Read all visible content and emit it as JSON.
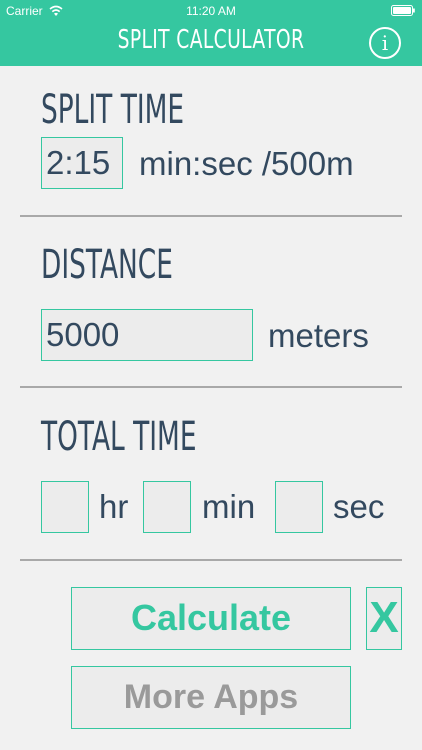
{
  "status_bar": {
    "carrier": "Carrier",
    "time": "11:20 AM",
    "wifi_icon": "wifi-icon",
    "battery_icon": "battery-full-icon"
  },
  "header": {
    "title": "SPLIT CALCULATOR",
    "info_icon": "info-icon",
    "info_label": "i"
  },
  "split_time": {
    "heading": "SPLIT TIME",
    "value": "2:15",
    "unit": "min:sec /500m"
  },
  "distance": {
    "heading": "DISTANCE",
    "value": "5000",
    "unit": "meters"
  },
  "total_time": {
    "heading": "TOTAL TIME",
    "hours_value": "",
    "hours_unit": "hr",
    "minutes_value": "",
    "minutes_unit": "min",
    "seconds_value": "",
    "seconds_unit": "sec"
  },
  "actions": {
    "calculate_label": "Calculate",
    "clear_label": "X",
    "more_apps_label": "More Apps"
  },
  "colors": {
    "accent": "#35c7a0",
    "text": "#33495f",
    "background": "#f1f1f1",
    "field_background": "#ececec",
    "disabled_text": "#9a9a9a",
    "divider": "#a9a9a9"
  }
}
